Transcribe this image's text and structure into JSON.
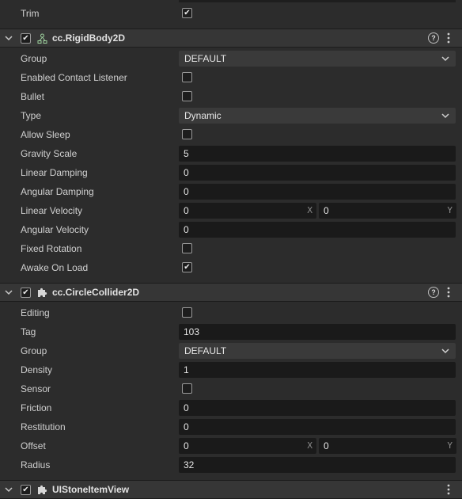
{
  "top": {
    "trim_label": "Trim",
    "trim_checked": true
  },
  "rigidbody": {
    "title": "cc.RigidBody2D",
    "group_label": "Group",
    "group_value": "DEFAULT",
    "contact_label": "Enabled Contact Listener",
    "bullet_label": "Bullet",
    "type_label": "Type",
    "type_value": "Dynamic",
    "sleep_label": "Allow Sleep",
    "gravity_label": "Gravity Scale",
    "gravity_value": "5",
    "lindamp_label": "Linear Damping",
    "lindamp_value": "0",
    "angdamp_label": "Angular Damping",
    "angdamp_value": "0",
    "linvel_label": "Linear Velocity",
    "linvel_x": "0",
    "linvel_y": "0",
    "angvel_label": "Angular Velocity",
    "angvel_value": "0",
    "fixedrot_label": "Fixed Rotation",
    "awake_label": "Awake On Load"
  },
  "circle": {
    "title": "cc.CircleCollider2D",
    "editing_label": "Editing",
    "tag_label": "Tag",
    "tag_value": "103",
    "group_label": "Group",
    "group_value": "DEFAULT",
    "density_label": "Density",
    "density_value": "1",
    "sensor_label": "Sensor",
    "friction_label": "Friction",
    "friction_value": "0",
    "restitution_label": "Restitution",
    "restitution_value": "0",
    "offset_label": "Offset",
    "offset_x": "0",
    "offset_y": "0",
    "radius_label": "Radius",
    "radius_value": "32"
  },
  "script": {
    "title": "UIStoneItemView"
  },
  "axis": {
    "x": "X",
    "y": "Y"
  },
  "check_glyph": "✔",
  "colors": {
    "panel_bg": "#2c2c2c",
    "header_bg": "#363636",
    "field_bg": "#1a1a1a",
    "select_bg": "#3a3a3a"
  }
}
